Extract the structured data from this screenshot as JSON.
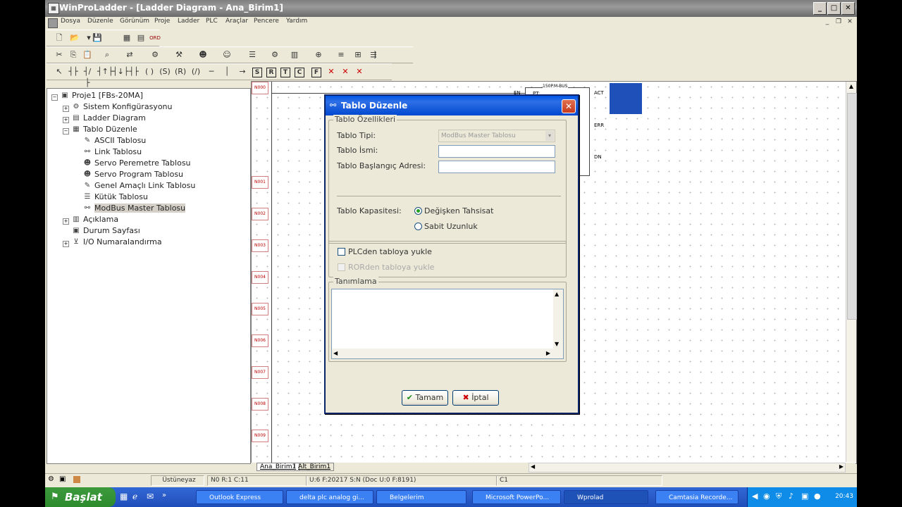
{
  "window": {
    "title": "WinProLadder - [Ladder Diagram - Ana_Birim1]"
  },
  "menu": [
    "Dosya",
    "Düzenle",
    "Görünüm",
    "Proje",
    "Ladder",
    "PLC",
    "Araçlar",
    "Pencere",
    "Yardım"
  ],
  "tree": {
    "root": "Proje1 [FBs-20MA]",
    "items": [
      {
        "label": "Sistem Konfigürasyonu"
      },
      {
        "label": "Ladder Diagram"
      },
      {
        "label": "Tablo Düzenle"
      },
      {
        "label": "ASCII Tablosu"
      },
      {
        "label": "Link Tablosu"
      },
      {
        "label": "Servo Peremetre Tablosu"
      },
      {
        "label": "Servo Program Tablosu"
      },
      {
        "label": "Genel Amaçlı Link Tablosu"
      },
      {
        "label": "Kütük Tablosu"
      },
      {
        "label": "ModBus Master Tablosu"
      },
      {
        "label": "Açıklama"
      },
      {
        "label": "Durum Sayfası"
      },
      {
        "label": "I/O Numaralandırma"
      }
    ]
  },
  "ladder": {
    "rungs": [
      "N000",
      "N001",
      "N002",
      "N003",
      "N004",
      "N005",
      "N006",
      "N007",
      "N008",
      "N009"
    ],
    "block": {
      "header": "150P.M-BUS",
      "pt": "PT:",
      "en": "EN",
      "act": "ACT",
      "err": "ERR",
      "dn": "DN"
    }
  },
  "sheet_tabs": [
    "Ana_Birim1",
    "Alt_Birim1"
  ],
  "status": {
    "mode": "Üstüneyaz",
    "pos": "N0 R:1 C:11",
    "mem": "U:6 F:20217 S:N (Doc U:0 F:8191)",
    "c": "C1"
  },
  "dialog": {
    "title": "Tablo Düzenle",
    "group_props": "Tablo Özellikleri",
    "type_label": "Tablo Tipi:",
    "type_value": "ModBus Master Tablosu",
    "name_label": "Tablo İsmi:",
    "addr_label": "Tablo Başlangıç Adresi:",
    "capacity_label": "Tablo Kapasitesi:",
    "radio_variable": "Değişken Tahsisat",
    "radio_fixed": "Sabit Uzunluk",
    "chk_plc": "PLCden tabloya yukle",
    "chk_ror": "RORden tabloya yukle",
    "group_desc": "Tanımlama",
    "ok": "Tamam",
    "cancel": "İptal"
  },
  "taskbar": {
    "start": "Başlat",
    "tasks": [
      "Outlook Express",
      "delta plc analog gi...",
      "Belgelerim",
      "Microsoft PowerPo...",
      "Wprolad",
      "Camtasia Recorde..."
    ],
    "clock": "20:43"
  },
  "colors": {
    "title_active": "#0055e5",
    "start": "#2d8a2d",
    "taskbar": "#2a5bc8"
  }
}
